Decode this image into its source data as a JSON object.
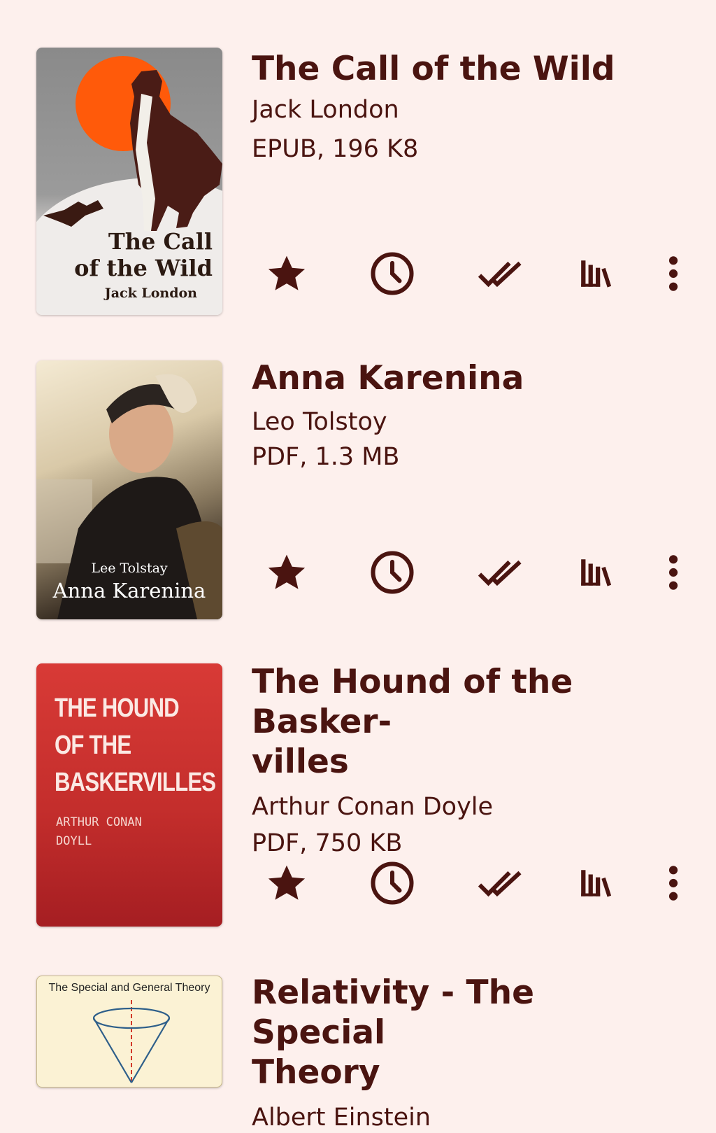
{
  "books": [
    {
      "title": "The Call of the Wild",
      "author": "Jack London",
      "meta": "EPUB, 196 K8",
      "cover_title": "The Call\nof the Wild",
      "cover_author": "Jack London"
    },
    {
      "title": "Anna Karenina",
      "author": "Leo Tolstoy",
      "meta": "PDF, 1.3 MB",
      "cover_title": "Anna Karenina",
      "cover_author": "Lee Tolstay"
    },
    {
      "title": "The Hound of the Basker-\nvilles",
      "author": "Arthur Conan Doyle",
      "meta": "PDF, 750 KB",
      "cover_title": "THE HOUND\nOF THE\nBASKERVILLES",
      "cover_author": "ARTHUR CONAN\nDOYLL"
    },
    {
      "title": "Relativity - The Special\nTheory",
      "author": "Albert Einstein",
      "cover_title": "The Special and General Theory"
    }
  ],
  "icons": [
    "star-icon",
    "clock-icon",
    "double-check-icon",
    "library-icon",
    "more-vert-icon"
  ],
  "colors": {
    "background": "#fdf0ed",
    "text": "#4a1410",
    "icon": "#4a1410"
  }
}
